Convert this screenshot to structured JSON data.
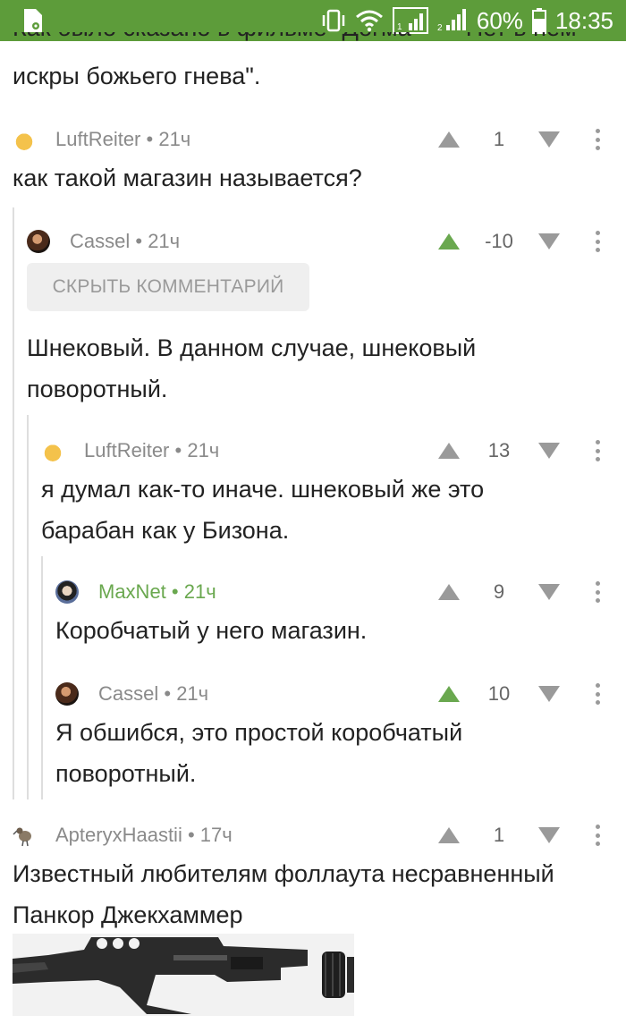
{
  "status_bar": {
    "battery_percent": "60%",
    "time": "18:35",
    "background": "#5d9c3a"
  },
  "top_text": {
    "line1_partial": "Как было сказано в фильме \"Догма\" — \"Нет в нем",
    "line2": "искры божьего гнева\"."
  },
  "comments": [
    {
      "author": "LuftReiter",
      "age": "21ч",
      "score": "1",
      "upvoted": false,
      "text": "как такой магазин называется?",
      "avatar_icon": "cheese-avatar-icon"
    },
    {
      "author": "Cassel",
      "age": "21ч",
      "score": "-10",
      "upvoted": true,
      "hide_label": "СКРЫТЬ КОММЕНТАРИЙ",
      "text": "Шнековый. В данном случае, шнековый поворотный.",
      "avatar_icon": "user-photo-avatar-icon"
    },
    {
      "author": "LuftReiter",
      "age": "21ч",
      "score": "13",
      "upvoted": false,
      "text": "я думал как-то иначе. шнековый же это барабан как у Бизона.",
      "avatar_icon": "cheese-avatar-icon"
    },
    {
      "author": "MaxNet",
      "age": "21ч",
      "score": "9",
      "upvoted": false,
      "text": "Коробчатый у него магазин.",
      "avatar_icon": "anime-avatar-icon"
    },
    {
      "author": "Cassel",
      "age": "21ч",
      "score": "10",
      "upvoted": true,
      "text": "Я обшибся, это простой коробчатый поворотный.",
      "avatar_icon": "user-photo-avatar-icon"
    },
    {
      "author": "ApteryxHaastii",
      "age": "17ч",
      "score": "1",
      "upvoted": false,
      "text": "Известный любителям фоллаута несравненный Панкор Джекхаммер",
      "avatar_icon": "bird-avatar-icon"
    }
  ],
  "colors": {
    "accent_green": "#6aa84f",
    "muted_gray": "#9a9a9a"
  }
}
